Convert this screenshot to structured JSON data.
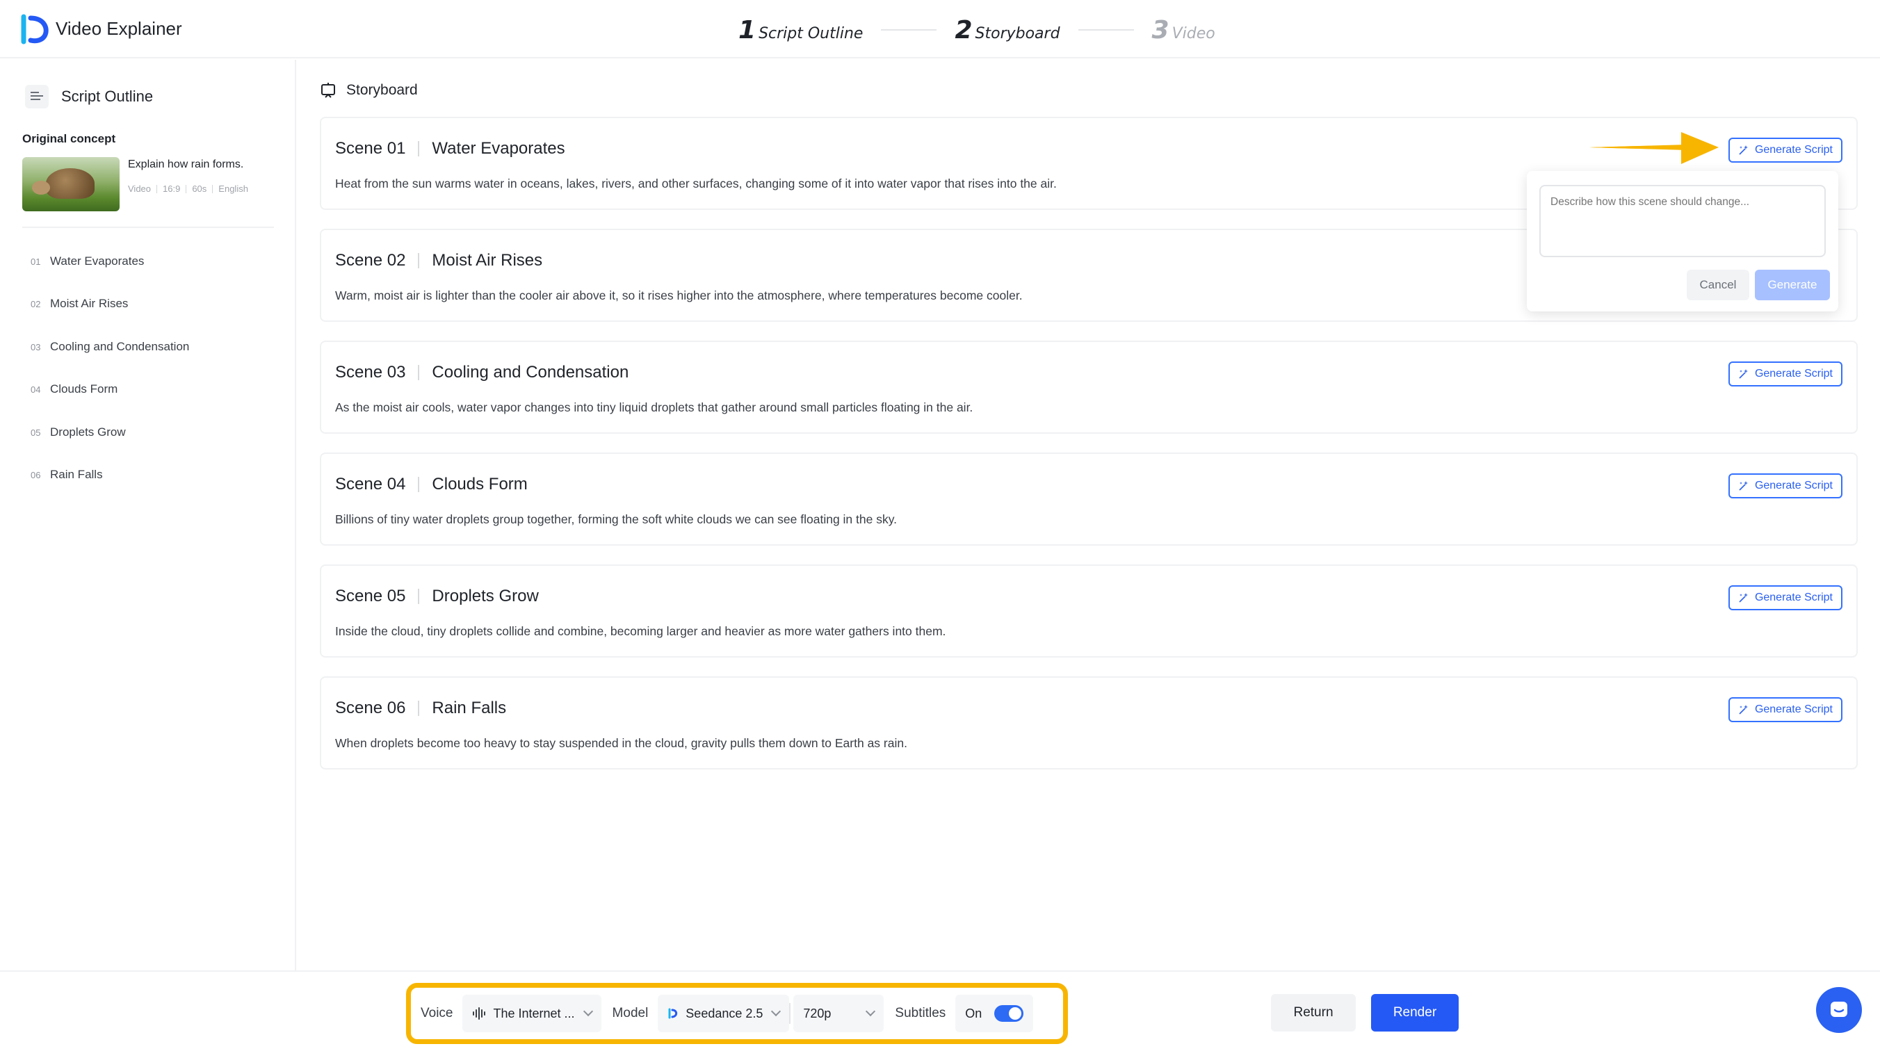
{
  "app": {
    "title": "Video Explainer"
  },
  "steps": [
    {
      "num": "1",
      "label": "Script Outline"
    },
    {
      "num": "2",
      "label": "Storyboard"
    },
    {
      "num": "3",
      "label": "Video"
    }
  ],
  "sidebar": {
    "title": "Script Outline",
    "concept_label": "Original concept",
    "concept_text": "Explain how rain forms.",
    "concept_meta": [
      "Video",
      "16:9",
      "60s",
      "English"
    ],
    "outline": [
      {
        "num": "01",
        "label": "Water Evaporates"
      },
      {
        "num": "02",
        "label": "Moist Air Rises"
      },
      {
        "num": "03",
        "label": "Cooling and Condensation"
      },
      {
        "num": "04",
        "label": "Clouds Form"
      },
      {
        "num": "05",
        "label": "Droplets Grow"
      },
      {
        "num": "06",
        "label": "Rain Falls"
      }
    ]
  },
  "main": {
    "title": "Storyboard",
    "generate_label": "Generate Script",
    "scenes": [
      {
        "num": "Scene 01",
        "title": "Water Evaporates",
        "desc": "Heat from the sun warms water in oceans, lakes, rivers, and other surfaces, changing some of it into water vapor that rises into the air."
      },
      {
        "num": "Scene 02",
        "title": "Moist Air Rises",
        "desc": "Warm, moist air is lighter than the cooler air above it, so it rises higher into the atmosphere, where temperatures become cooler."
      },
      {
        "num": "Scene 03",
        "title": "Cooling and Condensation",
        "desc": "As the moist air cools, water vapor changes into tiny liquid droplets that gather around small particles floating in the air."
      },
      {
        "num": "Scene 04",
        "title": "Clouds Form",
        "desc": "Billions of tiny water droplets group together, forming the soft white clouds we can see floating in the sky."
      },
      {
        "num": "Scene 05",
        "title": "Droplets Grow",
        "desc": "Inside the cloud, tiny droplets collide and combine, becoming larger and heavier as more water gathers into them."
      },
      {
        "num": "Scene 06",
        "title": "Rain Falls",
        "desc": "When droplets become too heavy to stay suspended in the cloud, gravity pulls them down to Earth as rain."
      }
    ]
  },
  "popover": {
    "placeholder": "Describe how this scene should change...",
    "cancel": "Cancel",
    "generate": "Generate"
  },
  "bottom": {
    "voice_label": "Voice",
    "voice_value": "The Internet ...",
    "model_label": "Model",
    "model_value": "Seedance 2.5",
    "resolution_value": "720p",
    "subtitles_label": "Subtitles",
    "subtitles_value": "On",
    "return": "Return",
    "render": "Render"
  },
  "colors": {
    "accent": "#2559f5",
    "highlight": "#f7b500"
  }
}
